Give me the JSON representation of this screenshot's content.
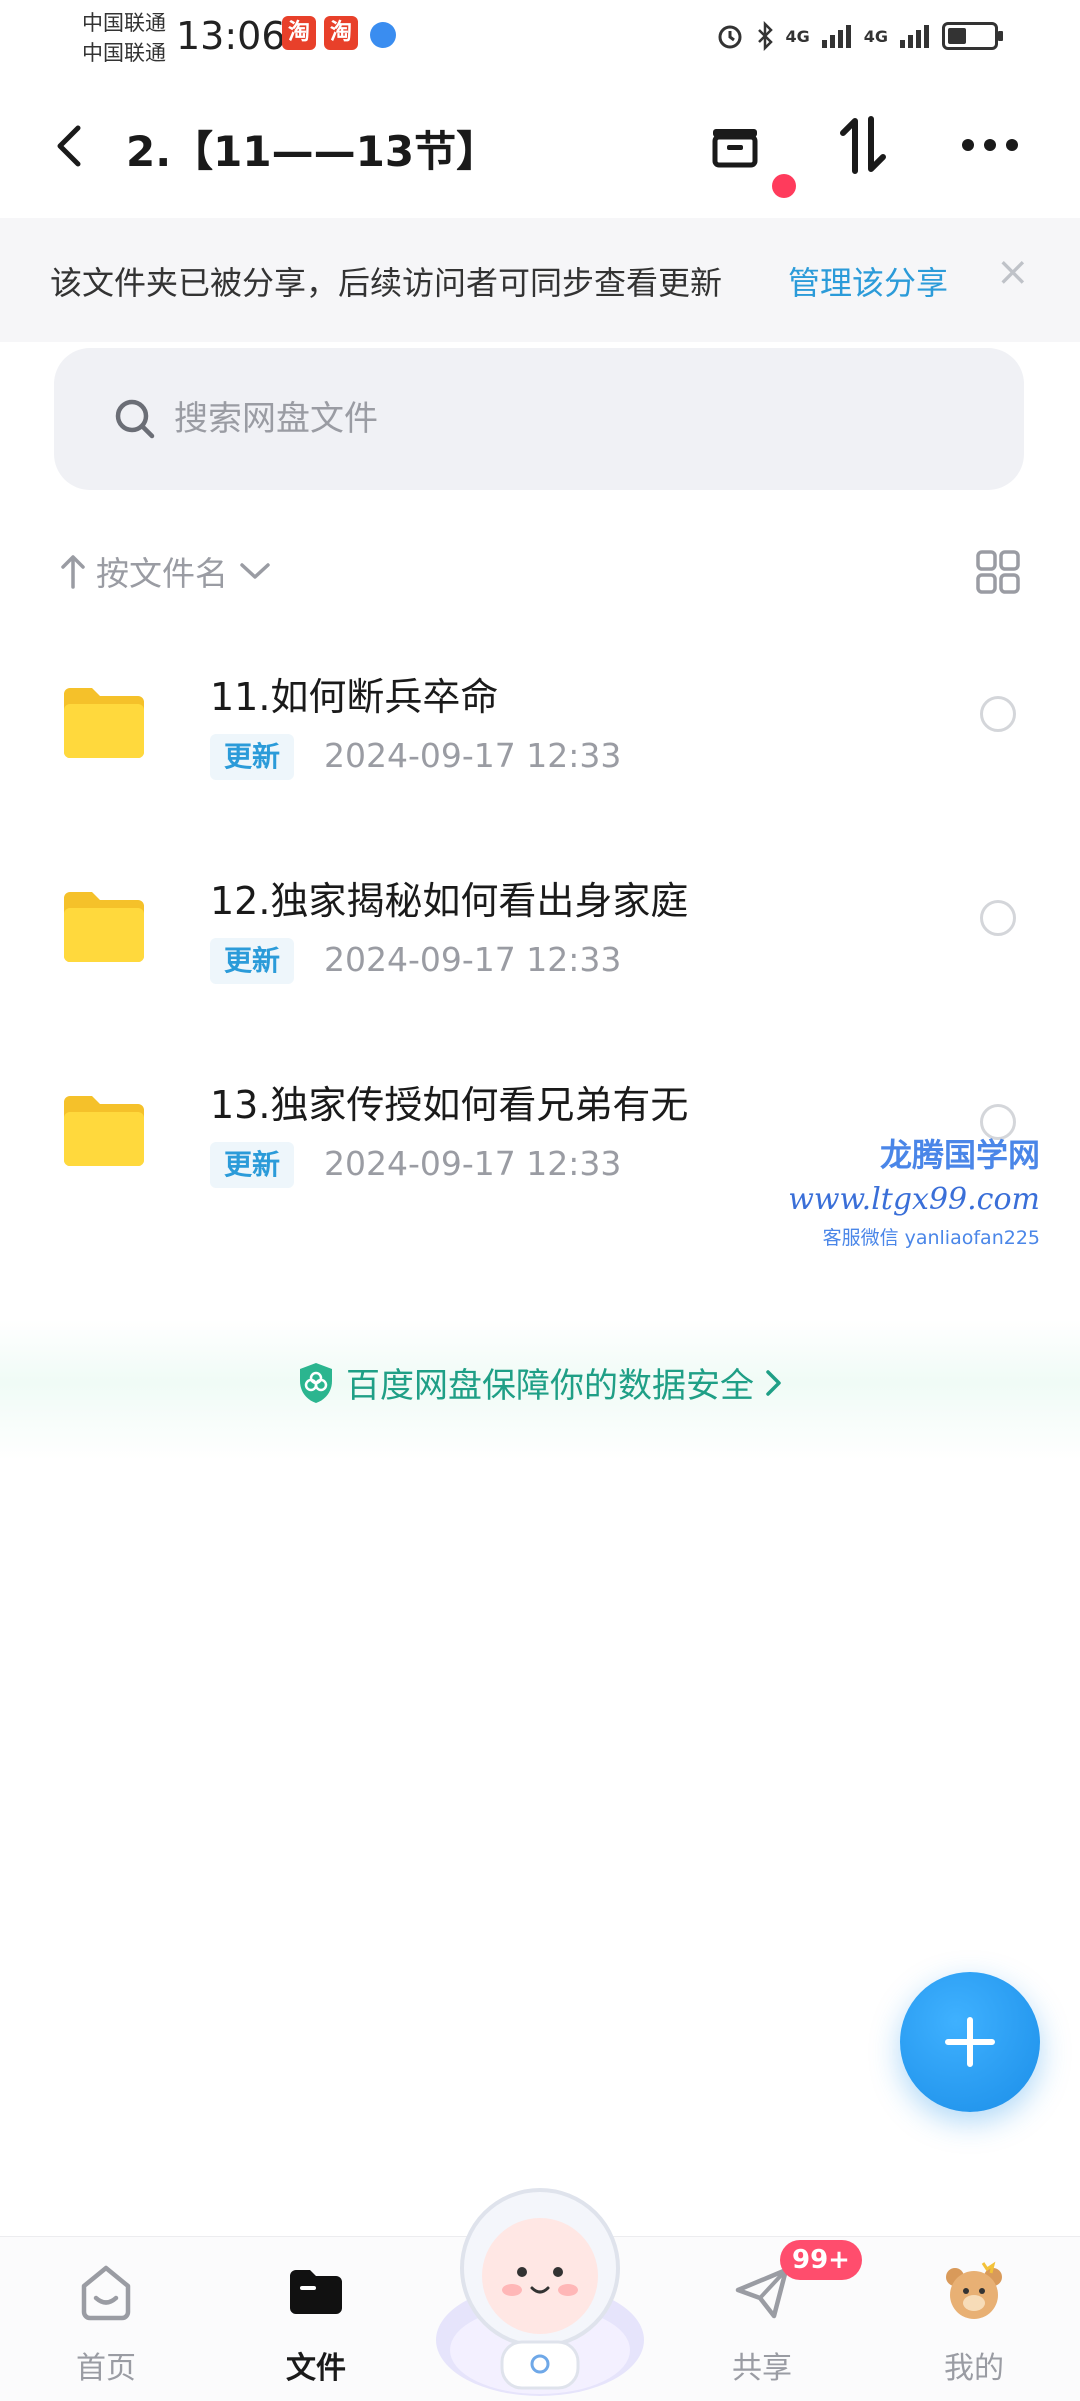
{
  "status_bar": {
    "carrier_1": "中国联通",
    "carrier_2": "中国联通",
    "time": "13:06",
    "badge_1": "淘",
    "badge_2": "淘",
    "network_1": "4G",
    "network_2": "4G",
    "icons": [
      "alarm-icon",
      "bluetooth-icon",
      "signal-icon",
      "battery-icon"
    ],
    "battery_level": 0.4
  },
  "header": {
    "title": "2.【11——13节】",
    "icons": [
      "back-arrow-icon",
      "inbox-icon",
      "sort-transfer-icon",
      "more-icon"
    ],
    "notification_dot": true
  },
  "share_banner": {
    "text": "该文件夹已被分享，后续访问者可同步查看更新",
    "link": "管理该分享",
    "close": "×"
  },
  "search": {
    "placeholder": "搜索网盘文件",
    "value": ""
  },
  "sort": {
    "label": "按文件名",
    "icons": [
      "up-arrow-icon",
      "chevron-down-icon",
      "grid-view-icon"
    ]
  },
  "files": [
    {
      "name": "11.如何断兵卒命",
      "tag": "更新",
      "date": "2024-09-17  12:33"
    },
    {
      "name": "12.独家揭秘如何看出身家庭",
      "tag": "更新",
      "date": "2024-09-17  12:33"
    },
    {
      "name": "13.独家传授如何看兄弟有无",
      "tag": "更新",
      "date": "2024-09-17  12:33"
    }
  ],
  "watermark": {
    "line1": "龙腾国学网",
    "line2": "www.ltgx99.com",
    "line3": "客服微信 yanliaofan225"
  },
  "security": {
    "text": "百度网盘保障你的数据安全"
  },
  "bottom_nav": {
    "items": [
      {
        "label": "首页",
        "icon": "home-icon",
        "active": false
      },
      {
        "label": "文件",
        "icon": "folder-icon",
        "active": true
      },
      {
        "label": "共享",
        "icon": "paper-plane-icon",
        "active": false
      },
      {
        "label": "我的",
        "icon": "bear-avatar-icon",
        "active": false
      }
    ],
    "share_badge": "99+"
  },
  "colors": {
    "accent": "#2b9bd9",
    "security": "#1f9f86",
    "fab": "#1b8ee8",
    "badge": "#ff4d6d",
    "folder": "#ffd23c"
  }
}
